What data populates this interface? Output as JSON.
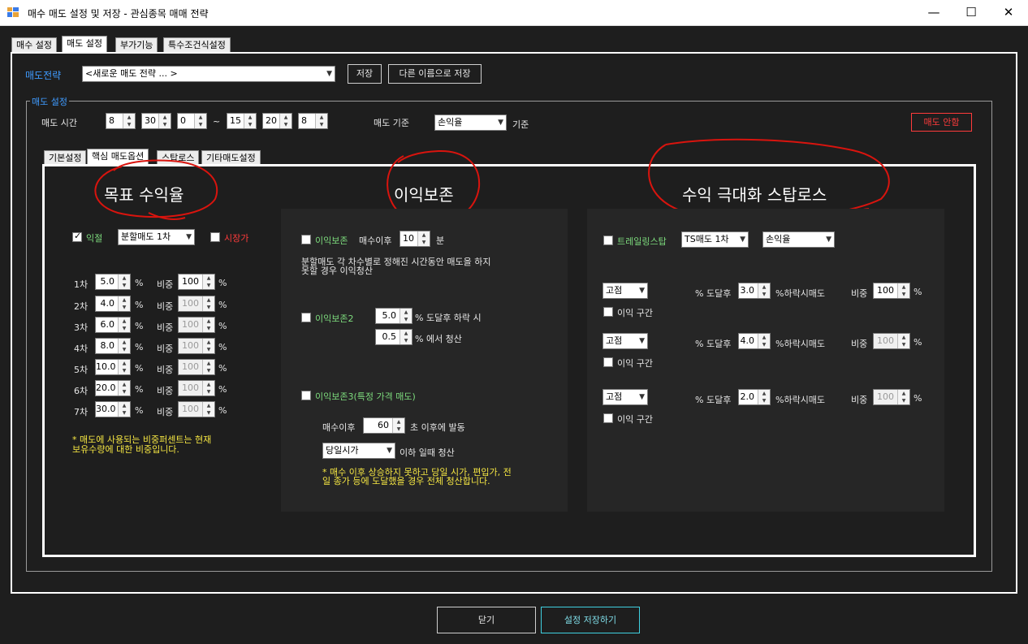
{
  "window": {
    "title": "매수 매도 설정 및 저장 - 관심종목 매매 전략",
    "minimize": "—",
    "maximize": "☐",
    "close": "✕"
  },
  "main_tabs": [
    "매수 설정",
    "매도 설정",
    "부가기능",
    "특수조건식설정"
  ],
  "strategy": {
    "label": "매도전략",
    "value": "<새로운 매도 전략 ... >",
    "save": "저장",
    "save_as": "다른 이름으로 저장"
  },
  "group": {
    "label": "매도 설정"
  },
  "time": {
    "label": "매도 시간",
    "start": [
      "8",
      "30",
      "0"
    ],
    "tilde": "~",
    "end": [
      "15",
      "20",
      "8"
    ]
  },
  "basis": {
    "label": "매도 기준",
    "value": "손익율",
    "suffix": "기준"
  },
  "no_sell_button": "매도 안함",
  "sub_tabs": [
    "기본설정",
    "핵심 매도옵션",
    "스탑로스",
    "기타매도설정"
  ],
  "section_titles": {
    "target": "목표 수익율",
    "preserve": "이익보존",
    "maximize": "수익 극대화  스탑로스"
  },
  "target": {
    "profit_label": "익절",
    "split_value": "분할매도 1차",
    "market_label": "시장가",
    "pct": "%",
    "weight": "비중",
    "rows": [
      {
        "label": "1차",
        "value": "5.0",
        "weight": "100"
      },
      {
        "label": "2차",
        "value": "4.0",
        "weight": "100"
      },
      {
        "label": "3차",
        "value": "6.0",
        "weight": "100"
      },
      {
        "label": "4차",
        "value": "8.0",
        "weight": "100"
      },
      {
        "label": "5차",
        "value": "10.0",
        "weight": "100"
      },
      {
        "label": "6차",
        "value": "20.0",
        "weight": "100"
      },
      {
        "label": "7차",
        "value": "30.0",
        "weight": "100"
      }
    ],
    "note": "* 매도에 사용되는 비중퍼센트는 현재\n보유수량에 대한 비중입니다."
  },
  "preserve": {
    "p1_label": "이익보존",
    "p1_after": "매수이후",
    "p1_value": "10",
    "p1_unit": "분",
    "p1_desc": "분할매도 각 차수별로 정해진 시간동안 매도을 하지\n못할 경우 이익청산",
    "p2_label": "이익보존2",
    "p2_v1": "5.0",
    "p2_t1": "% 도달후 하락 시",
    "p2_v2": "0.5",
    "p2_t2": "% 에서 청산",
    "p3_label": "이익보존3(특정 가격 매도)",
    "p3_after": "매수이후",
    "p3_value": "60",
    "p3_t": "초 이후에 발동",
    "p3_combo": "당일시가",
    "p3_t2": "이하 일때 청산",
    "p3_note": "* 매수 이후 상승하지 못하고 당일 시가, 편입가, 전\n일 종가 등에 도달했을 경우 전체 청산합니다."
  },
  "trailing": {
    "label": "트레일링스탑",
    "combo1": "TS매도 1차",
    "combo2": "손익율",
    "rows": [
      {
        "mode": "고점",
        "reach": "% 도달후",
        "value": "3.0",
        "drop": "%하락시매도",
        "weight_label": "비중",
        "weight": "100",
        "pct": "%",
        "range": "이익 구간"
      },
      {
        "mode": "고점",
        "reach": "% 도달후",
        "value": "4.0",
        "drop": "%하락시매도",
        "weight_label": "비중",
        "weight": "100",
        "pct": "%",
        "range": "이익 구간"
      },
      {
        "mode": "고점",
        "reach": "% 도달후",
        "value": "2.0",
        "drop": "%하락시매도",
        "weight_label": "비중",
        "weight": "100",
        "pct": "%",
        "range": "이익 구간"
      }
    ]
  },
  "bottom": {
    "close": "닫기",
    "save_settings": "설정 저장하기"
  }
}
